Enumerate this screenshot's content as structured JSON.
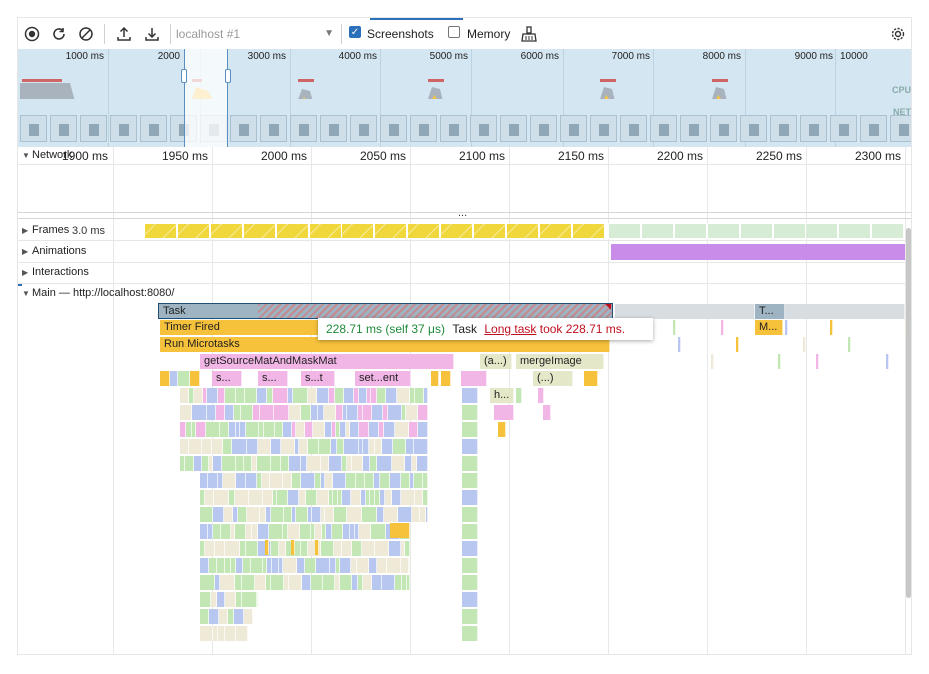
{
  "toolbar": {
    "url_select": "localhost #1",
    "screenshots_label": "Screenshots",
    "screenshots_checked": true,
    "memory_label": "Memory",
    "memory_checked": false
  },
  "overview": {
    "time_labels": [
      "1000 ms",
      "2000",
      "3000 ms",
      "4000 ms",
      "5000 ms",
      "6000 ms",
      "7000 ms",
      "8000 ms",
      "9000 ms",
      "10000"
    ],
    "side_labels": [
      "CPU",
      "NET"
    ]
  },
  "ruler": {
    "labels": [
      "1900 ms",
      "1950 ms",
      "2000 ms",
      "2050 ms",
      "2100 ms",
      "2150 ms",
      "2200 ms",
      "2250 ms",
      "2300 ms"
    ]
  },
  "tracks": {
    "network": "Network",
    "frames": "Frames",
    "frames_time": "3.0 ms",
    "animations": "Animations",
    "interactions": "Interactions",
    "main": "Main — http://localhost:8080/",
    "ellipsis": "..."
  },
  "flame": {
    "task": "Task",
    "timer_fired": "Timer Fired",
    "run_microtasks": "Run Microtasks",
    "get_source": "getSourceMatAndMaskMat",
    "a_call": "(a...)",
    "merge_image": "mergeImage",
    "s1": "s...",
    "s2": "s...",
    "st": "s...t",
    "set_ent": "set...ent",
    "anon": "(...)",
    "h": "h...",
    "t_short": "T...",
    "m_short": "M..."
  },
  "tooltip": {
    "time": "228.71 ms (self 37 μs)",
    "name": "Task",
    "link": "Long task",
    "warning": "took 228.71 ms."
  },
  "colors": {
    "accent": "#2c6fbb",
    "task_gray": "#9fb4c2",
    "timer_yellow": "#f7c23b",
    "function_pink": "#f1b6e6",
    "frame_yellow": "#f0d73c",
    "frame_green": "#d6ecd4",
    "animation_purple": "#c98ce9",
    "js_green": "#c3e6b5",
    "js_blue": "#b7c7ef",
    "js_beige": "#efe9d8",
    "long_task_red": "#c0111f"
  }
}
